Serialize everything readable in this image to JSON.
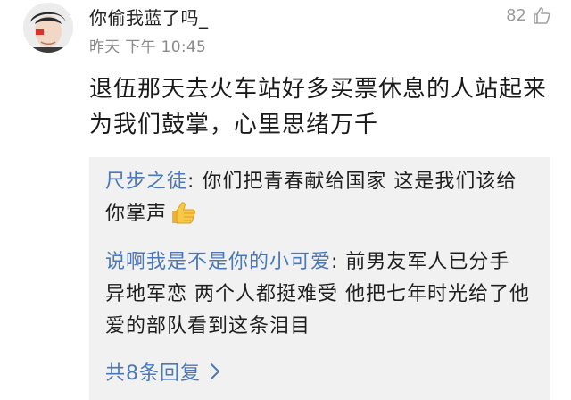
{
  "comment": {
    "username": "你偷我蓝了吗_",
    "timestamp": "昨天 下午 10:45",
    "like_count": "82",
    "text": "退伍那天去火车站好多买票休息的人站起来为我们鼓掌，心里思绪万千"
  },
  "replies": [
    {
      "author": "尺步之徒",
      "separator": ": ",
      "text": "你们把青春献给国家 这是我们该给你掌声",
      "emoji": "thumbs-up-icon"
    },
    {
      "author": "说啊我是不是你的小可爱",
      "separator": ": ",
      "text": "前男友军人已分手 异地军恋 两个人都挺难受 他把七年时光给了他爱的部队看到这条泪目"
    }
  ],
  "more_replies": {
    "label": "共8条回复",
    "icon": "chevron-right-icon"
  },
  "colors": {
    "author": "#4a78b8",
    "reply_bg": "#f1f1f1",
    "meta": "#8a8a8a",
    "text": "#1a1a1a"
  }
}
